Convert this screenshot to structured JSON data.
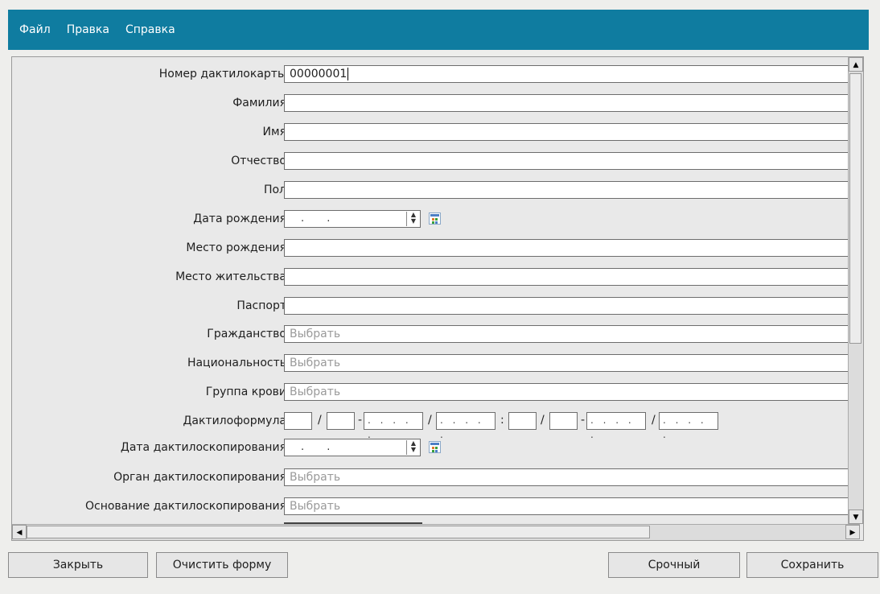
{
  "menu": [
    "Файл",
    "Правка",
    "Справка"
  ],
  "form": {
    "card_number": {
      "label": "Номер дактилокарты",
      "value": "00000001"
    },
    "surname": {
      "label": "Фамилия",
      "value": ""
    },
    "name": {
      "label": "Имя",
      "value": ""
    },
    "patronymic": {
      "label": "Отчество",
      "value": ""
    },
    "sex": {
      "label": "Пол",
      "value": ""
    },
    "birth_date": {
      "label": "Дата рождения",
      "value": ". ."
    },
    "birth_place": {
      "label": "Место рождения",
      "value": ""
    },
    "residence": {
      "label": "Место жительства",
      "value": ""
    },
    "passport": {
      "label": "Паспорт",
      "value": ""
    },
    "citizenship": {
      "label": "Гражданство",
      "placeholder": "Выбрать"
    },
    "nationality": {
      "label": "Национальность",
      "placeholder": "Выбрать"
    },
    "blood_group": {
      "label": "Группа крови",
      "placeholder": "Выбрать"
    },
    "dactyloformula": {
      "label": "Дактилоформула",
      "separators": [
        "/",
        "-",
        "/",
        ":",
        "/",
        "-",
        "/"
      ],
      "dots": ". . . . ."
    },
    "dactyl_date": {
      "label": "Дата дактилоскопирования",
      "value": ". ."
    },
    "dactyl_org": {
      "label": "Орган дактилоскопирования",
      "placeholder": "Выбрать"
    },
    "dactyl_reason": {
      "label": "Основание дактилоскопирования",
      "placeholder": "Выбрать"
    }
  },
  "buttons": {
    "close": "Закрыть",
    "clear": "Очистить форму",
    "urgent": "Срочный",
    "save": "Сохранить"
  }
}
